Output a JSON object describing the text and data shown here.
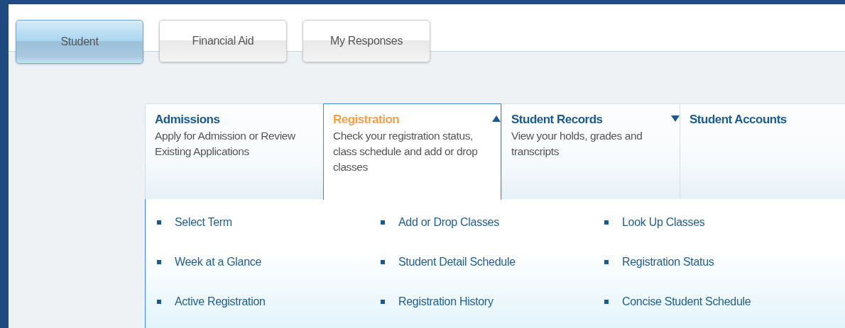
{
  "tabs": [
    {
      "label": "Student",
      "selected": true
    },
    {
      "label": "Financial Aid",
      "selected": false
    },
    {
      "label": "My Responses",
      "selected": false
    }
  ],
  "categories": [
    {
      "kind": "link",
      "title": "Admissions",
      "description": "Apply for Admission or Review Existing Applications",
      "selected": false
    },
    {
      "kind": "menu",
      "title": "Registration",
      "description": "Check your registration status, class schedule and add or drop classes",
      "selected": true
    },
    {
      "kind": "menu",
      "title": "Student Records",
      "description": "View your holds, grades and transcripts",
      "selected": false
    },
    {
      "kind": "link",
      "title": "Student Accounts",
      "selected": false
    }
  ],
  "links": [
    [
      "Select Term",
      "Week at a Glance",
      "Active Registration"
    ],
    [
      "Add or Drop Classes",
      "Student Detail Schedule",
      "Registration History"
    ],
    [
      "Look Up Classes",
      "Registration Status",
      "Concise Student Schedule"
    ]
  ]
}
